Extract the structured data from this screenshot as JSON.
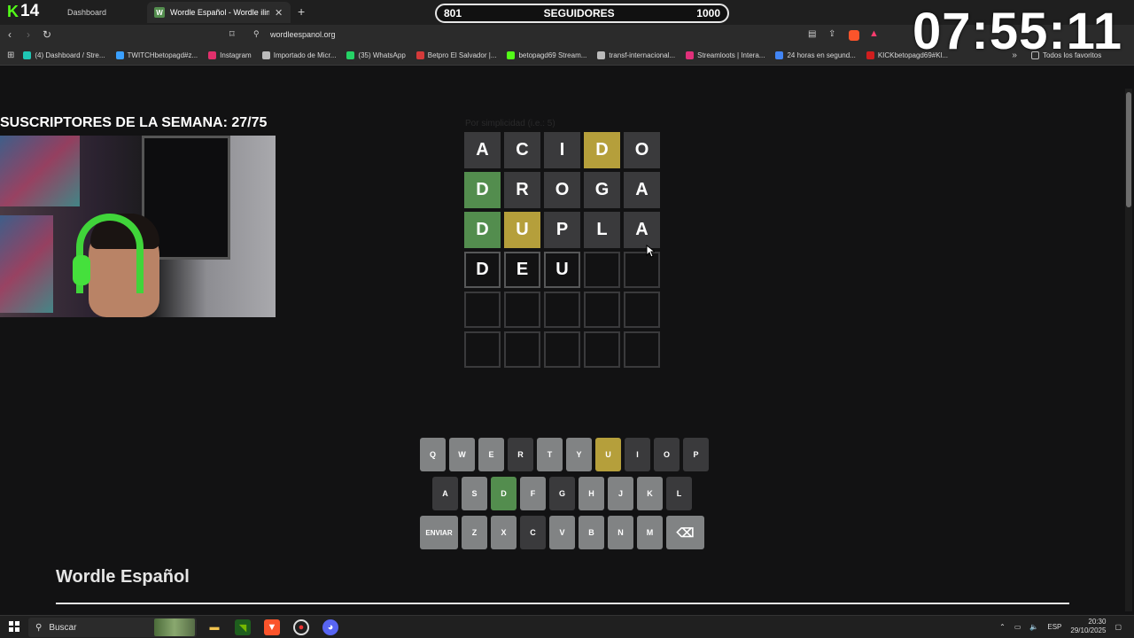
{
  "browser": {
    "tabs": [
      {
        "label": "Dashboard",
        "favicon": "kick-favicon-icon",
        "active": false
      },
      {
        "label": "Wordle Español - Wordle ilimitado",
        "favicon": "wordle-favicon-icon",
        "active": true
      }
    ],
    "url": "wordleespanol.org",
    "bookmarks": [
      {
        "label": "(4) Dashboard / Stre...",
        "color": "#1fc7b5"
      },
      {
        "label": "TWITCHbetopagd#z...",
        "color": "#3aa0ff"
      },
      {
        "label": "Instagram",
        "color": "#e1306c"
      },
      {
        "label": "Importado de Micr...",
        "color": "#bbbbbb"
      },
      {
        "label": "(35) WhatsApp",
        "color": "#25d366"
      },
      {
        "label": "Betpro El Salvador |...",
        "color": "#d43a3a"
      },
      {
        "label": "betopagd69 Stream...",
        "color": "#53fc18"
      },
      {
        "label": "transf-internacional...",
        "color": "#bbbbbb"
      },
      {
        "label": "Streamloots | Intera...",
        "color": "#e0307a"
      },
      {
        "label": "24 horas en segund...",
        "color": "#4285f4"
      },
      {
        "label": "KICKbetopagd69#Kl...",
        "color": "#d01e1e"
      }
    ],
    "all_favorites": "Todos los favoritos"
  },
  "overlay": {
    "kick_badge": {
      "letter": "K",
      "count": "14"
    },
    "followers": {
      "current": "801",
      "label": "SEGUIDORES",
      "goal": "1000"
    },
    "clock": "07:55:11",
    "subs_title": "SUSCRIPTORES DE LA SEMANA: 27/75"
  },
  "game": {
    "hint": "Por simplicidad (i.e.: 5)",
    "rows": [
      [
        {
          "l": "A",
          "s": "absent"
        },
        {
          "l": "C",
          "s": "absent"
        },
        {
          "l": "I",
          "s": "absent"
        },
        {
          "l": "D",
          "s": "present"
        },
        {
          "l": "O",
          "s": "absent"
        }
      ],
      [
        {
          "l": "D",
          "s": "correct"
        },
        {
          "l": "R",
          "s": "absent"
        },
        {
          "l": "O",
          "s": "absent"
        },
        {
          "l": "G",
          "s": "absent"
        },
        {
          "l": "A",
          "s": "absent"
        }
      ],
      [
        {
          "l": "D",
          "s": "correct"
        },
        {
          "l": "U",
          "s": "present"
        },
        {
          "l": "P",
          "s": "absent"
        },
        {
          "l": "L",
          "s": "absent"
        },
        {
          "l": "A",
          "s": "absent"
        }
      ],
      [
        {
          "l": "D",
          "s": "tbd"
        },
        {
          "l": "E",
          "s": "tbd"
        },
        {
          "l": "U",
          "s": "tbd"
        },
        {
          "l": "",
          "s": "empty"
        },
        {
          "l": "",
          "s": "empty"
        }
      ],
      [
        {
          "l": "",
          "s": "empty"
        },
        {
          "l": "",
          "s": "empty"
        },
        {
          "l": "",
          "s": "empty"
        },
        {
          "l": "",
          "s": "empty"
        },
        {
          "l": "",
          "s": "empty"
        }
      ],
      [
        {
          "l": "",
          "s": "empty"
        },
        {
          "l": "",
          "s": "empty"
        },
        {
          "l": "",
          "s": "empty"
        },
        {
          "l": "",
          "s": "empty"
        },
        {
          "l": "",
          "s": "empty"
        }
      ]
    ],
    "keyboard": [
      [
        {
          "k": "Q",
          "s": "unused"
        },
        {
          "k": "W",
          "s": "unused"
        },
        {
          "k": "E",
          "s": "unused"
        },
        {
          "k": "R",
          "s": "absent"
        },
        {
          "k": "T",
          "s": "unused"
        },
        {
          "k": "Y",
          "s": "unused"
        },
        {
          "k": "U",
          "s": "present"
        },
        {
          "k": "I",
          "s": "absent"
        },
        {
          "k": "O",
          "s": "absent"
        },
        {
          "k": "P",
          "s": "absent"
        }
      ],
      [
        {
          "k": "A",
          "s": "absent"
        },
        {
          "k": "S",
          "s": "unused"
        },
        {
          "k": "D",
          "s": "correct"
        },
        {
          "k": "F",
          "s": "unused"
        },
        {
          "k": "G",
          "s": "absent"
        },
        {
          "k": "H",
          "s": "unused"
        },
        {
          "k": "J",
          "s": "unused"
        },
        {
          "k": "K",
          "s": "unused"
        },
        {
          "k": "L",
          "s": "absent"
        }
      ],
      [
        {
          "k": "ENVIAR",
          "s": "unused",
          "wide": true
        },
        {
          "k": "Z",
          "s": "unused"
        },
        {
          "k": "X",
          "s": "unused"
        },
        {
          "k": "C",
          "s": "absent"
        },
        {
          "k": "V",
          "s": "unused"
        },
        {
          "k": "B",
          "s": "unused"
        },
        {
          "k": "N",
          "s": "unused"
        },
        {
          "k": "M",
          "s": "unused"
        },
        {
          "k": "⌫",
          "s": "unused",
          "wide": true
        }
      ]
    ]
  },
  "page": {
    "heading": "Wordle Español"
  },
  "taskbar": {
    "search_placeholder": "Buscar",
    "language": "ESP",
    "time": "20:30",
    "date": "29/10/2025"
  },
  "colors": {
    "correct": "#538d4e",
    "present": "#b59f3b",
    "absent": "#3a3a3c",
    "unused": "#818384",
    "kick_green": "#53fc18"
  }
}
